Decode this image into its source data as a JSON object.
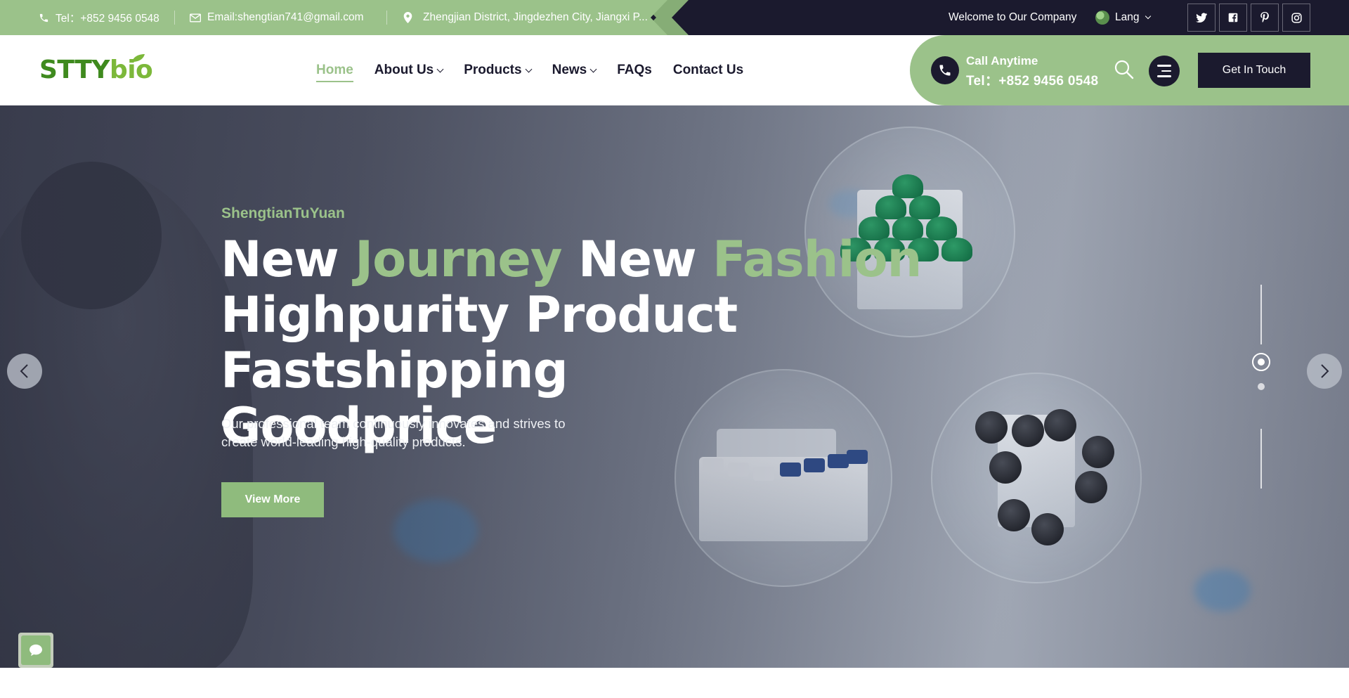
{
  "topbar": {
    "phone": "Tel：+852 9456 0548",
    "email": "Email:shengtian741@gmail.com",
    "address": "Zhengjian District, Jingdezhen City, Jiangxi P...",
    "welcome": "Welcome to Our Company",
    "lang": "Lang",
    "social": [
      "twitter-icon",
      "facebook-icon",
      "pinterest-icon",
      "instagram-icon"
    ]
  },
  "header": {
    "logo_part1": "STTY",
    "logo_part2": "bio",
    "nav": [
      {
        "label": "Home",
        "dropdown": false,
        "active": true
      },
      {
        "label": "About Us",
        "dropdown": true
      },
      {
        "label": "Products",
        "dropdown": true
      },
      {
        "label": "News",
        "dropdown": true
      },
      {
        "label": "FAQs",
        "dropdown": false
      },
      {
        "label": "Contact Us",
        "dropdown": false
      }
    ],
    "call_label": "Call Anytime",
    "call_number": "Tel：+852 9456 0548",
    "cta": "Get In Touch"
  },
  "hero": {
    "eyebrow": "ShengtianTuYuan",
    "headline_1a": "New ",
    "headline_1b": "Journey",
    "headline_1c": " New ",
    "headline_1d": "Fashion",
    "headline_2": "Highpurity Product Fastshipping",
    "headline_3": "Goodprice",
    "description": "Our professional team continuously innovates and strives to create world-leading high-quality products.",
    "button": "View More",
    "slides_total": 2,
    "slide_active": 1
  },
  "colors": {
    "accent_green": "#9bc28a",
    "dark_navy": "#1b1a2e",
    "logo_green": "#3f8a1e"
  }
}
